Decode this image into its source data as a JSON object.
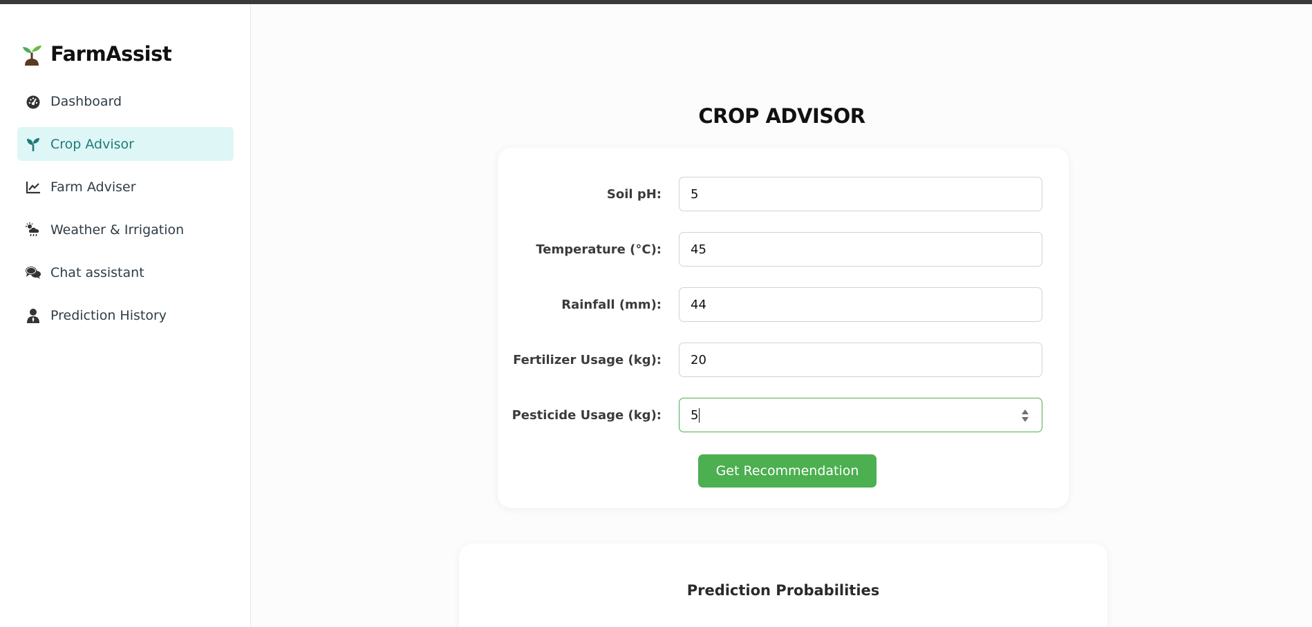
{
  "app": {
    "name": "FarmAssist",
    "logo_icon": "sprout-icon"
  },
  "sidebar": {
    "items": [
      {
        "label": "Dashboard",
        "icon": "gauge-icon",
        "active": false
      },
      {
        "label": "Crop Advisor",
        "icon": "seedling-icon",
        "active": true
      },
      {
        "label": "Farm Adviser",
        "icon": "line-chart-icon",
        "active": false
      },
      {
        "label": "Weather & Irrigation",
        "icon": "cloud-sun-rain-icon",
        "active": false
      },
      {
        "label": "Chat assistant",
        "icon": "comments-icon",
        "active": false
      },
      {
        "label": "Prediction History",
        "icon": "user-tie-icon",
        "active": false
      }
    ]
  },
  "page": {
    "title": "CROP ADVISOR"
  },
  "form": {
    "fields": [
      {
        "label": "Soil pH:",
        "value": "5"
      },
      {
        "label": "Temperature (°C):",
        "value": "45"
      },
      {
        "label": "Rainfall (mm):",
        "value": "44"
      },
      {
        "label": "Fertilizer Usage (kg):",
        "value": "20"
      },
      {
        "label": "Pesticide Usage (kg):",
        "value": "5",
        "focused": true
      }
    ],
    "submit_label": "Get Recommendation"
  },
  "results": {
    "title": "Prediction Probabilities"
  },
  "colors": {
    "accent": "#4caf50",
    "active_nav_bg": "#def6f6",
    "active_nav_text": "#1f7a77"
  }
}
